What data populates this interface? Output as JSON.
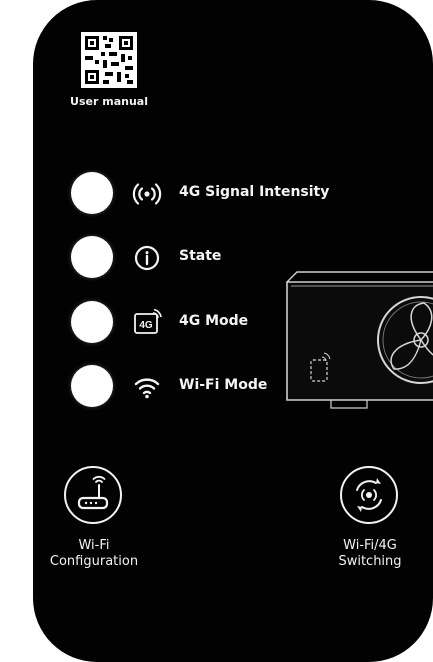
{
  "user_manual": {
    "label": "User manual",
    "icon": "qr-code-icon"
  },
  "indicators": [
    {
      "label": "4G Signal Intensity",
      "icon": "signal-broadcast-icon"
    },
    {
      "label": "State",
      "icon": "info-icon"
    },
    {
      "label": "4G Mode",
      "icon": "4g-icon"
    },
    {
      "label": "Wi-Fi Mode",
      "icon": "wifi-icon"
    }
  ],
  "buttons": {
    "wifi_configuration": {
      "label": "Wi-Fi\nConfiguration",
      "icon": "router-icon"
    },
    "wifi_4g_switching": {
      "label": "Wi-Fi/4G\nSwitching",
      "icon": "switch-signal-icon"
    }
  },
  "colors": {
    "panel": "#020202",
    "text": "#f4f4f4",
    "led": "#ffffff"
  }
}
